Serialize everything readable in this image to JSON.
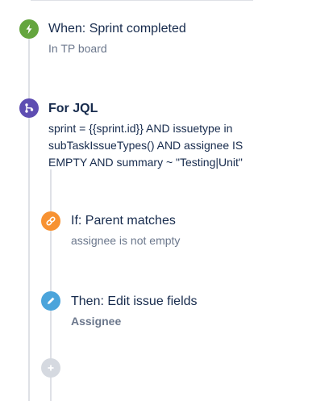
{
  "trigger": {
    "title": "When: Sprint completed",
    "subtitle": "In TP board",
    "icon": "lightning-bolt-icon",
    "color": "#64a53e"
  },
  "branch": {
    "title": "For JQL",
    "query_lines": [
      "sprint = {{sprint.id}} AND issuetype in",
      "subTaskIssueTypes() AND assignee IS",
      "EMPTY AND summary ~ \"Testing|Unit\""
    ],
    "icon": "branch-icon",
    "color": "#5e4db2"
  },
  "condition": {
    "title": "If: Parent matches",
    "subtitle": "assignee is not empty",
    "icon": "link-icon",
    "color": "#f79232"
  },
  "action": {
    "title": "Then: Edit issue fields",
    "subtitle": "Assignee",
    "icon": "pencil-icon",
    "color": "#4ba4db"
  },
  "add_step": {
    "icon": "plus-icon",
    "color": "#c1c7d0"
  },
  "line_color": "#dfe1e6"
}
